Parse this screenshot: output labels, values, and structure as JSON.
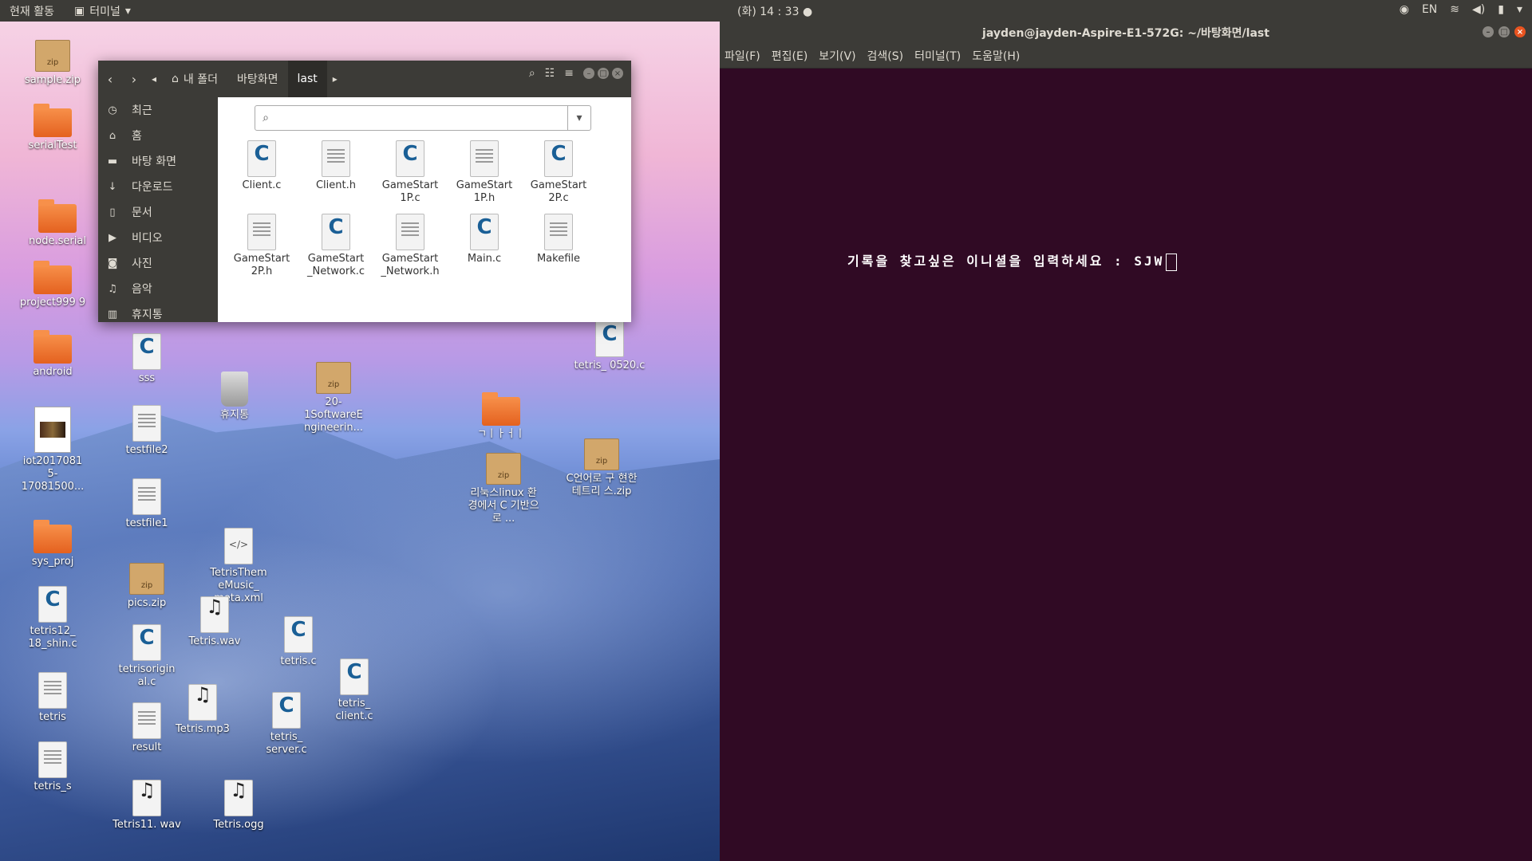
{
  "top_panel": {
    "activities": "현재 활동",
    "app_name": "터미널",
    "clock": "(화) 14 : 33 ●",
    "lang": "EN"
  },
  "terminal": {
    "title": "jayden@jayden-Aspire-E1-572G: ~/바탕화면/last",
    "menu": [
      "파일(F)",
      "편집(E)",
      "보기(V)",
      "검색(S)",
      "터미널(T)",
      "도움말(H)"
    ],
    "prompt_text": "기록을 찾고싶은 이니셜을 입력하세요  : SJW"
  },
  "file_manager": {
    "breadcrumbs": [
      "내 폴더",
      "바탕화면",
      "last"
    ],
    "sidebar": [
      "최근",
      "홈",
      "바탕 화면",
      "다운로드",
      "문서",
      "비디오",
      "사진",
      "음악",
      "휴지통"
    ],
    "files": [
      {
        "name": "Client.c",
        "type": "cfile"
      },
      {
        "name": "Client.h",
        "type": "doc"
      },
      {
        "name": "GameStart 1P.c",
        "type": "cfile"
      },
      {
        "name": "GameStart 1P.h",
        "type": "doc"
      },
      {
        "name": "GameStart 2P.c",
        "type": "cfile"
      },
      {
        "name": "GameStart 2P.h",
        "type": "doc"
      },
      {
        "name": "GameStart _Network.c",
        "type": "cfile"
      },
      {
        "name": "GameStart _Network.h",
        "type": "doc"
      },
      {
        "name": "Main.c",
        "type": "cfile"
      },
      {
        "name": "Makefile",
        "type": "doc"
      }
    ]
  },
  "desktop_icons": [
    {
      "name": "sample.zip",
      "type": "zip"
    },
    {
      "name": "serialTest",
      "type": "folder"
    },
    {
      "name": "node.serial",
      "type": "folder"
    },
    {
      "name": "project999 9",
      "type": "folder"
    },
    {
      "name": "android",
      "type": "folder"
    },
    {
      "name": "iot2017081 5- 17081500...",
      "type": "image"
    },
    {
      "name": "sys_proj",
      "type": "folder"
    },
    {
      "name": "tetris12_ 18_shin.c",
      "type": "cfile"
    },
    {
      "name": "tetris",
      "type": "doc"
    },
    {
      "name": "tetris_s",
      "type": "doc"
    },
    {
      "name": "sss",
      "type": "cfile"
    },
    {
      "name": "testfile2",
      "type": "doc"
    },
    {
      "name": "testfile1",
      "type": "doc"
    },
    {
      "name": "pics.zip",
      "type": "zip"
    },
    {
      "name": "tetrisorigin al.c",
      "type": "cfile"
    },
    {
      "name": "result",
      "type": "doc"
    },
    {
      "name": "Tetris11. wav",
      "type": "audio"
    },
    {
      "name": "휴지통",
      "type": "trash"
    },
    {
      "name": "TetrisThem eMusic_ meta.xml",
      "type": "xml"
    },
    {
      "name": "Tetris.wav",
      "type": "audio"
    },
    {
      "name": "Tetris.mp3",
      "type": "audio"
    },
    {
      "name": "Tetris.ogg",
      "type": "audio"
    },
    {
      "name": "tetris_ server.c",
      "type": "cfile"
    },
    {
      "name": "tetris.c",
      "type": "cfile"
    },
    {
      "name": "tetris_ client.c",
      "type": "cfile"
    },
    {
      "name": "20- 1SoftwareE ngineerin...",
      "type": "zip"
    },
    {
      "name": "ㄱㅣㅏㅓㅣ",
      "type": "folder"
    },
    {
      "name": "리눅스linux 환경에서 C 기반으로 ...",
      "type": "zip"
    },
    {
      "name": "tetris_ 0520.c",
      "type": "cfile"
    },
    {
      "name": "C언어로 구 현한 테트리 스.zip",
      "type": "zip"
    }
  ]
}
